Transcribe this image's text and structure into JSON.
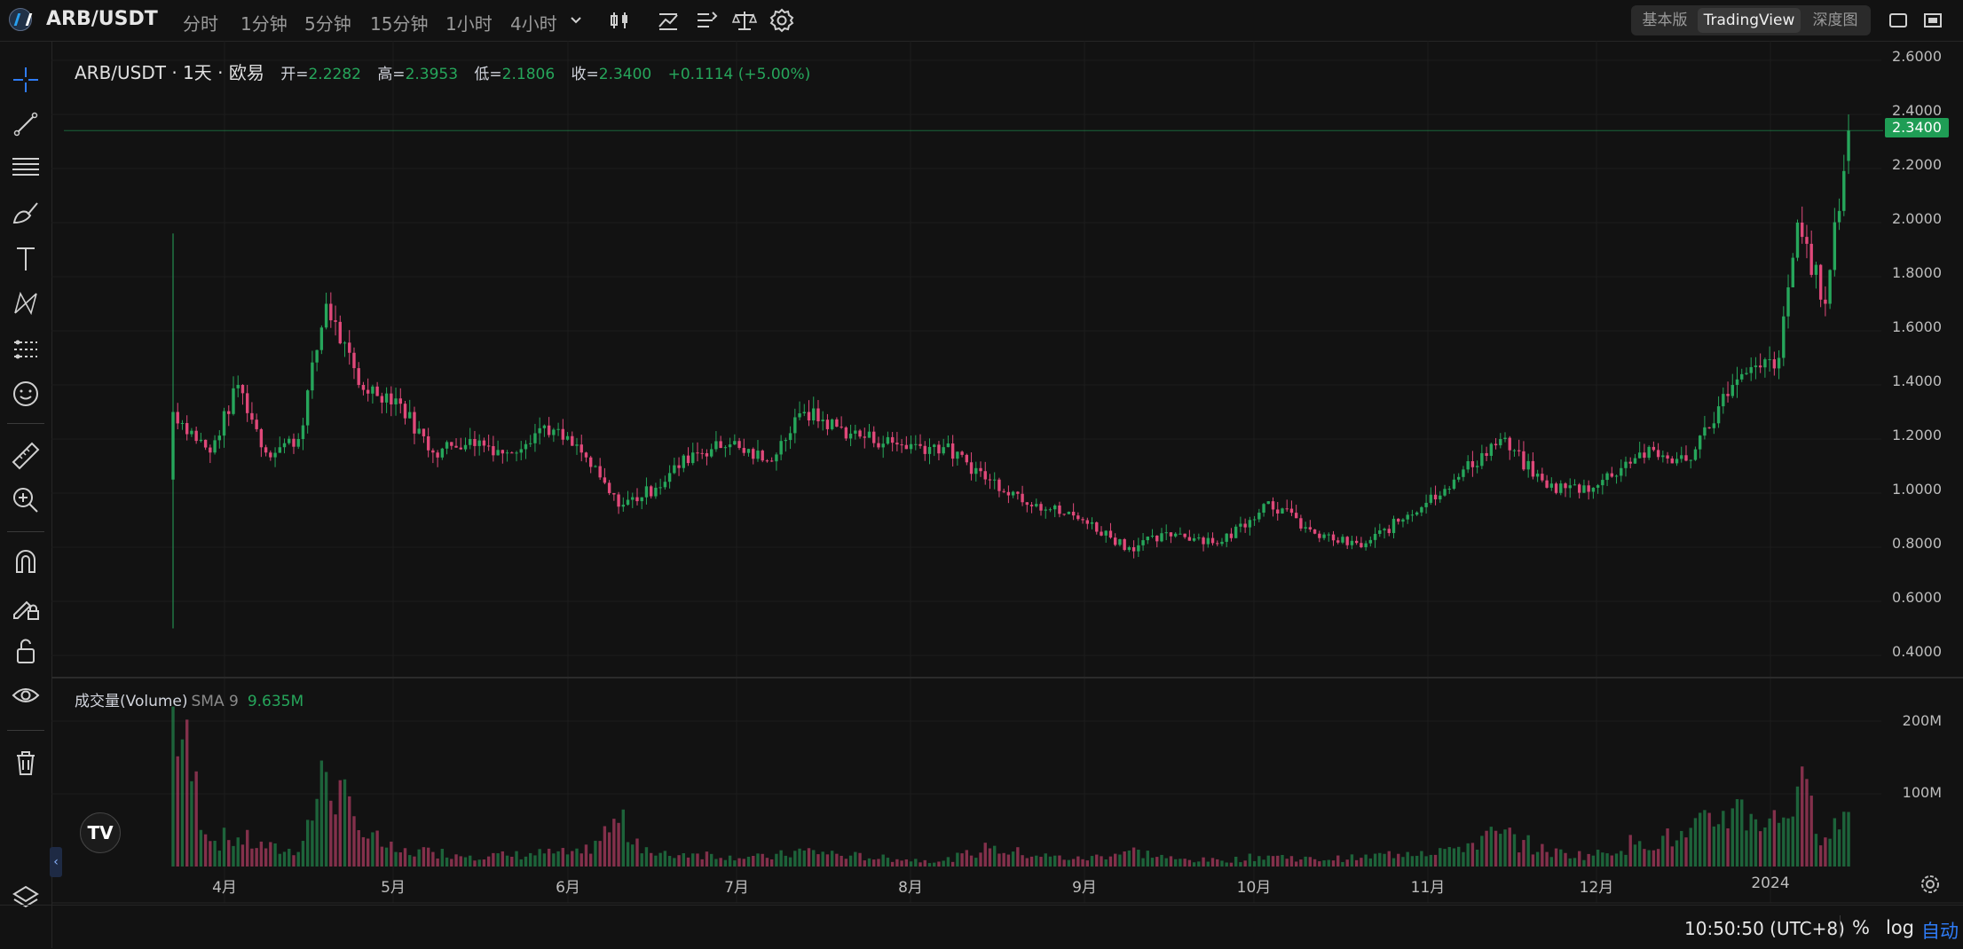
{
  "header": {
    "pair": "ARB/USDT",
    "intervals": [
      "分时",
      "1分钟",
      "5分钟",
      "15分钟",
      "1小时",
      "4小时"
    ],
    "view_options": [
      "基本版",
      "TradingView",
      "深度图"
    ],
    "active_view": "TradingView"
  },
  "legend": {
    "title": "ARB/USDT · 1天 · 欧易",
    "open_label": "开=",
    "open": "2.2282",
    "high_label": "高=",
    "high": "2.3953",
    "low_label": "低=",
    "low": "2.1806",
    "close_label": "收=",
    "close": "2.3400",
    "change": "+0.1114 (+5.00%)"
  },
  "volume_legend": {
    "label": "成交量(Volume)",
    "sma": "SMA 9",
    "value": "9.635M"
  },
  "price_axis": [
    "2.6000",
    "2.4000",
    "2.2000",
    "2.0000",
    "1.8000",
    "1.6000",
    "1.4000",
    "1.2000",
    "1.0000",
    "0.8000",
    "0.6000",
    "0.4000"
  ],
  "volume_axis": [
    "200M",
    "100M"
  ],
  "last_price": "2.3400",
  "time_axis": [
    "4月",
    "5月",
    "6月",
    "7月",
    "8月",
    "9月",
    "10月",
    "11月",
    "12月",
    "2024"
  ],
  "footer": {
    "time": "10:50:50 (UTC+8)",
    "percent": "%",
    "log": "log",
    "auto": "自动"
  },
  "colors": {
    "up": "#26a65b",
    "down": "#e0497a",
    "background": "#121212",
    "accent": "#2f7cf6"
  },
  "chart_data": {
    "type": "candlestick",
    "title": "ARB/USDT · 1天 · 欧易",
    "ylim": [
      0.4,
      2.6
    ],
    "volume_ylim_M": [
      0,
      220
    ],
    "anchors": [
      {
        "x": 0,
        "c": 1.3,
        "v": 220,
        "low": 0.5,
        "high": 1.96
      },
      {
        "x": 8,
        "c": 1.15,
        "v": 35
      },
      {
        "x": 14,
        "c": 1.4,
        "v": 40
      },
      {
        "x": 20,
        "c": 1.15,
        "v": 25
      },
      {
        "x": 27,
        "c": 1.2,
        "v": 20
      },
      {
        "x": 33,
        "c": 1.7,
        "v": 130
      },
      {
        "x": 40,
        "c": 1.4,
        "v": 50
      },
      {
        "x": 48,
        "c": 1.35,
        "v": 20
      },
      {
        "x": 56,
        "c": 1.15,
        "v": 20
      },
      {
        "x": 64,
        "c": 1.2,
        "v": 15
      },
      {
        "x": 72,
        "c": 1.15,
        "v": 15
      },
      {
        "x": 80,
        "c": 1.25,
        "v": 18
      },
      {
        "x": 88,
        "c": 1.15,
        "v": 18
      },
      {
        "x": 96,
        "c": 0.95,
        "v": 60
      },
      {
        "x": 104,
        "c": 1.02,
        "v": 15
      },
      {
        "x": 112,
        "c": 1.15,
        "v": 18
      },
      {
        "x": 120,
        "c": 1.18,
        "v": 15
      },
      {
        "x": 128,
        "c": 1.12,
        "v": 12
      },
      {
        "x": 136,
        "c": 1.3,
        "v": 22
      },
      {
        "x": 146,
        "c": 1.22,
        "v": 15
      },
      {
        "x": 156,
        "c": 1.18,
        "v": 10
      },
      {
        "x": 166,
        "c": 1.17,
        "v": 8
      },
      {
        "x": 176,
        "c": 1.05,
        "v": 25
      },
      {
        "x": 186,
        "c": 0.96,
        "v": 15
      },
      {
        "x": 196,
        "c": 0.9,
        "v": 10
      },
      {
        "x": 206,
        "c": 0.8,
        "v": 22
      },
      {
        "x": 216,
        "c": 0.85,
        "v": 10
      },
      {
        "x": 226,
        "c": 0.82,
        "v": 8
      },
      {
        "x": 236,
        "c": 0.97,
        "v": 15
      },
      {
        "x": 246,
        "c": 0.85,
        "v": 10
      },
      {
        "x": 256,
        "c": 0.8,
        "v": 12
      },
      {
        "x": 266,
        "c": 0.92,
        "v": 20
      },
      {
        "x": 276,
        "c": 1.05,
        "v": 25
      },
      {
        "x": 286,
        "c": 1.2,
        "v": 45
      },
      {
        "x": 296,
        "c": 1.02,
        "v": 20
      },
      {
        "x": 306,
        "c": 1.02,
        "v": 15
      },
      {
        "x": 316,
        "c": 1.15,
        "v": 35
      },
      {
        "x": 326,
        "c": 1.12,
        "v": 40
      },
      {
        "x": 336,
        "c": 1.4,
        "v": 80
      },
      {
        "x": 346,
        "c": 1.5,
        "v": 60
      },
      {
        "x": 350,
        "c": 2.0,
        "v": 110
      },
      {
        "x": 356,
        "c": 1.7,
        "v": 40
      },
      {
        "x": 361,
        "c": 2.34,
        "v": 75,
        "low": 2.18,
        "high": 2.4
      }
    ]
  }
}
